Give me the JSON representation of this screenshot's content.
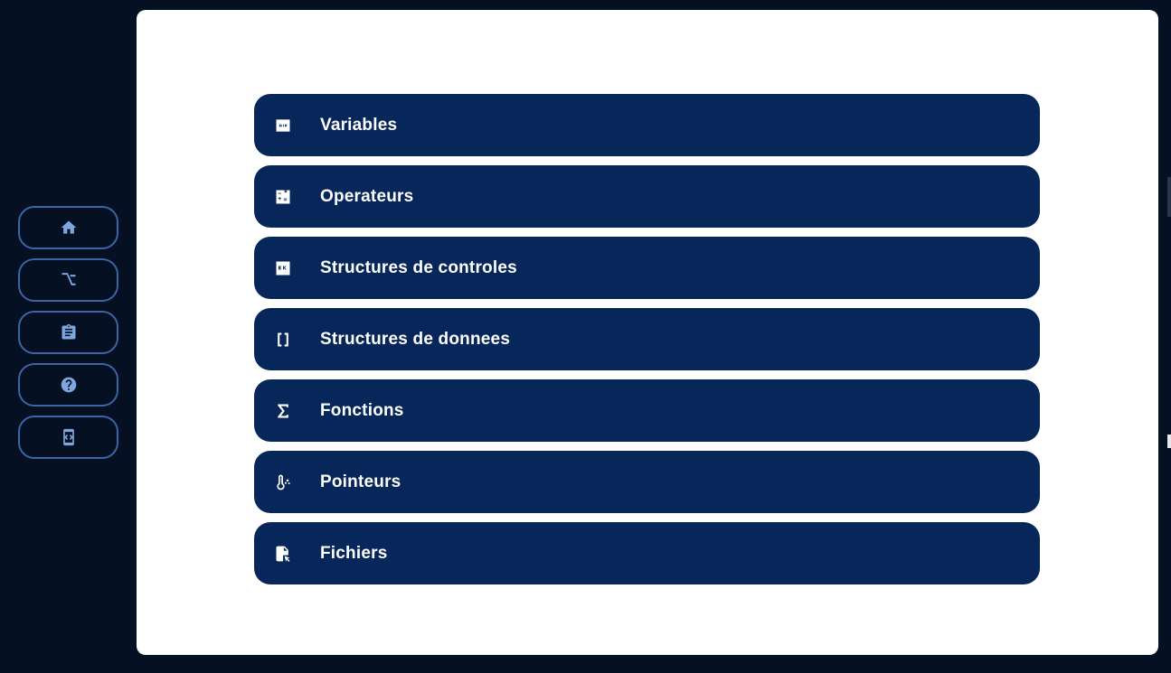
{
  "sidebar": {
    "buttons": [
      {
        "name": "home",
        "icon": "home-icon"
      },
      {
        "name": "branch",
        "icon": "option-key-icon"
      },
      {
        "name": "clipboard",
        "icon": "clipboard-icon"
      },
      {
        "name": "help",
        "icon": "help-circle-icon"
      },
      {
        "name": "code",
        "icon": "code-device-icon"
      }
    ]
  },
  "menu": {
    "items": [
      {
        "label": "Variables",
        "icon": "gif-box-icon"
      },
      {
        "label": "Operateurs",
        "icon": "calculator-icon"
      },
      {
        "label": "Structures de controles",
        "icon": "control-box-icon"
      },
      {
        "label": "Structures de donnees",
        "icon": "brackets-icon"
      },
      {
        "label": "Fonctions",
        "icon": "sigma-icon"
      },
      {
        "label": "Pointeurs",
        "icon": "thermometer-pointer-icon"
      },
      {
        "label": "Fichiers",
        "icon": "file-cursor-icon"
      }
    ]
  },
  "colors": {
    "background": "#051022",
    "panel": "#ffffff",
    "menu_item": "#07265a",
    "sidebar_border": "#3c64a6",
    "sidebar_icon": "#7ea7de"
  }
}
